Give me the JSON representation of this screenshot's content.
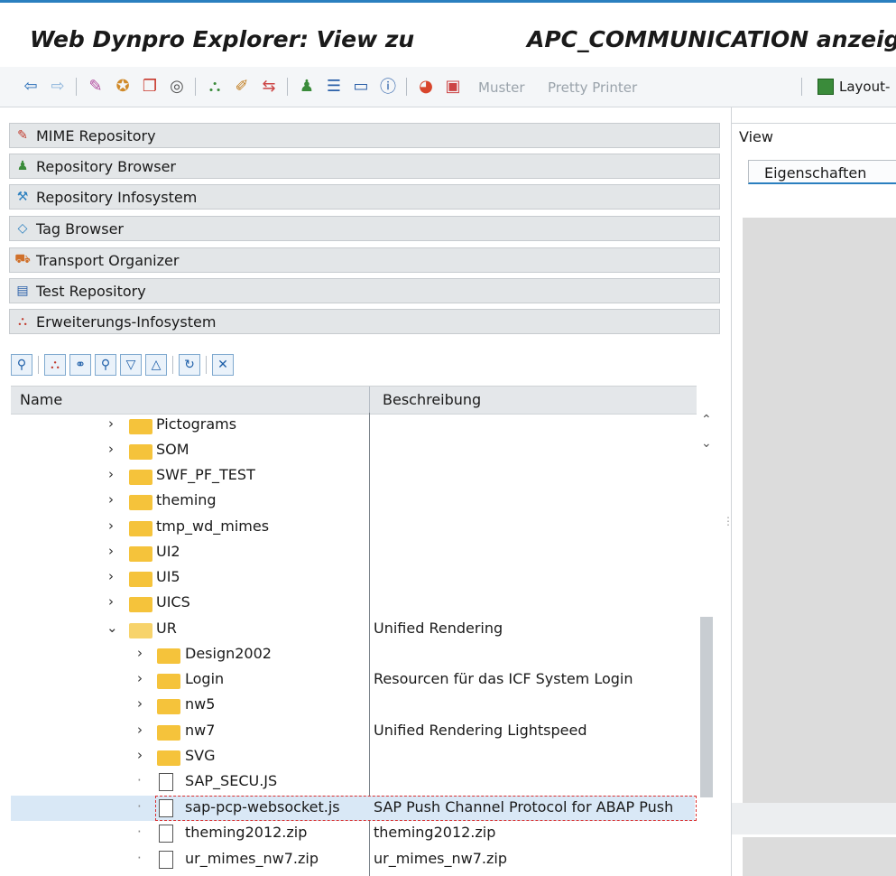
{
  "window": {
    "title_left": "Web Dynpro Explorer: View zu",
    "title_right": "APC_COMMUNICATION anzeig"
  },
  "toolbar": {
    "muster_label": "Muster",
    "pretty_printer_label": "Pretty Printer",
    "layout_label": "Layout-"
  },
  "navigation": {
    "items": [
      {
        "label": "MIME Repository",
        "icon": "mime-repository-icon"
      },
      {
        "label": "Repository Browser",
        "icon": "repository-browser-icon"
      },
      {
        "label": "Repository Infosystem",
        "icon": "repository-infosystem-icon"
      },
      {
        "label": "Tag Browser",
        "icon": "tag-browser-icon"
      },
      {
        "label": "Transport Organizer",
        "icon": "transport-organizer-icon"
      },
      {
        "label": "Test Repository",
        "icon": "test-repository-icon"
      },
      {
        "label": "Erweiterungs-Infosystem",
        "icon": "enhancement-infosystem-icon"
      }
    ]
  },
  "tree": {
    "columns": {
      "name": "Name",
      "description": "Beschreibung"
    },
    "rows": [
      {
        "name": "Pictograms",
        "desc": "",
        "type": "folder",
        "level": 1
      },
      {
        "name": "SOM",
        "desc": "",
        "type": "folder",
        "level": 1
      },
      {
        "name": "SWF_PF_TEST",
        "desc": "",
        "type": "folder",
        "level": 1
      },
      {
        "name": "theming",
        "desc": "",
        "type": "folder",
        "level": 1
      },
      {
        "name": "tmp_wd_mimes",
        "desc": "",
        "type": "folder",
        "level": 1
      },
      {
        "name": "UI2",
        "desc": "",
        "type": "folder",
        "level": 1
      },
      {
        "name": "UI5",
        "desc": "",
        "type": "folder",
        "level": 1
      },
      {
        "name": "UICS",
        "desc": "",
        "type": "folder",
        "level": 1
      },
      {
        "name": "UR",
        "desc": "Unified Rendering",
        "type": "folder-open",
        "level": 1
      },
      {
        "name": "Design2002",
        "desc": "",
        "type": "folder",
        "level": 2
      },
      {
        "name": "Login",
        "desc": "Resourcen für das ICF System Login",
        "type": "folder",
        "level": 2
      },
      {
        "name": "nw5",
        "desc": "",
        "type": "folder",
        "level": 2
      },
      {
        "name": "nw7",
        "desc": "Unified Rendering Lightspeed",
        "type": "folder",
        "level": 2
      },
      {
        "name": "SVG",
        "desc": "",
        "type": "folder",
        "level": 2
      },
      {
        "name": "SAP_SECU.JS",
        "desc": "",
        "type": "file",
        "level": 2
      },
      {
        "name": "sap-pcp-websocket.js",
        "desc": "SAP Push Channel Protocol for ABAP Push",
        "type": "file",
        "level": 2,
        "selected": true
      },
      {
        "name": "theming2012.zip",
        "desc": "theming2012.zip",
        "type": "file",
        "level": 2
      },
      {
        "name": "ur_mimes_nw7.zip",
        "desc": "ur_mimes_nw7.zip",
        "type": "file",
        "level": 2
      }
    ]
  },
  "right_panel": {
    "view_label": "View",
    "tab_label": "Eigenschaften"
  }
}
